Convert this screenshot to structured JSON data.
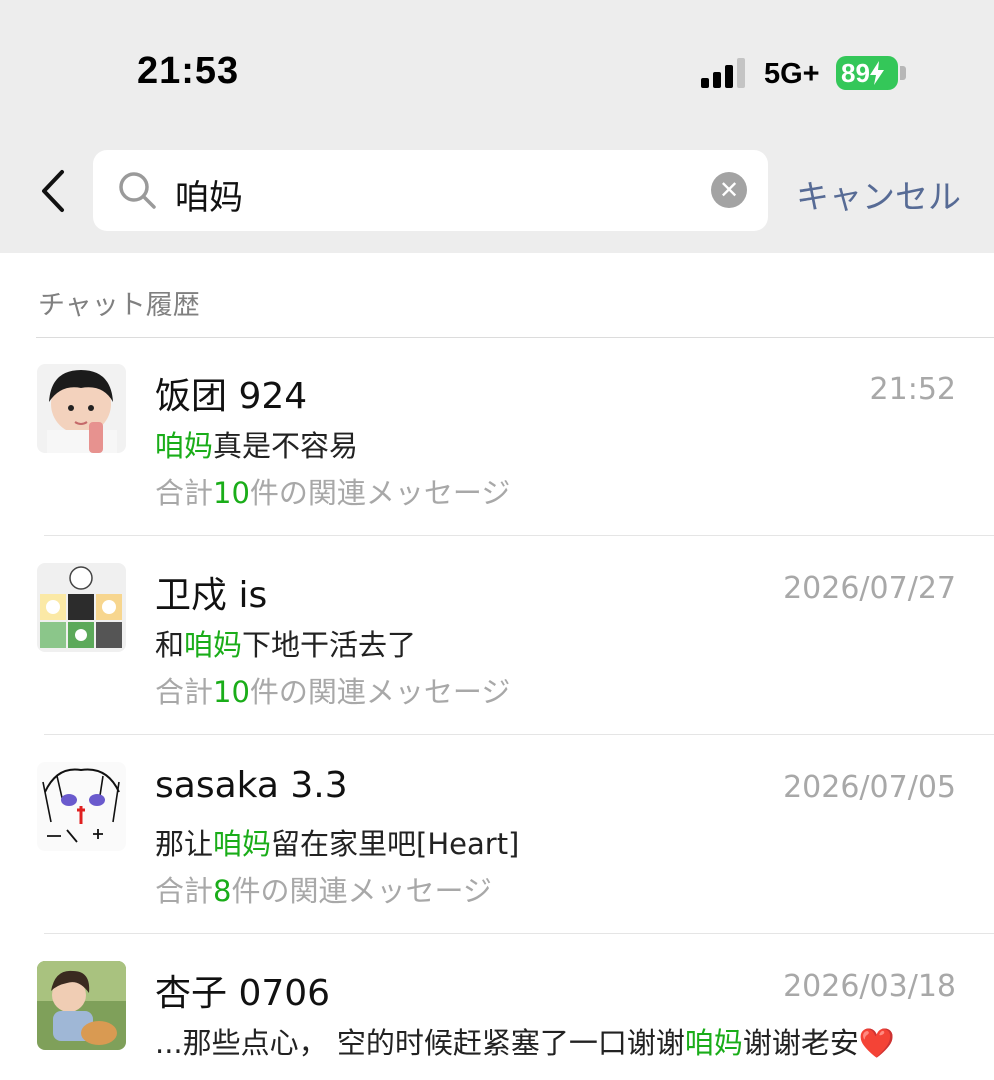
{
  "status_bar": {
    "time": "21:53",
    "network": "5G+",
    "battery": "89"
  },
  "search": {
    "query": "咱妈",
    "cancel_label": "キャンセル"
  },
  "section": {
    "title": "チャット履歴"
  },
  "results": [
    {
      "name": "饭团 924",
      "date": "21:52",
      "snippet_before": "",
      "snippet_highlight": "咱妈",
      "snippet_after": "真是不容易",
      "count_prefix": "合計",
      "count_number": "10",
      "count_suffix": "件の関連メッセージ"
    },
    {
      "name": "卫戍 is",
      "date": "2026/07/27",
      "snippet_before": "和",
      "snippet_highlight": "咱妈",
      "snippet_after": "下地干活去了",
      "count_prefix": "合計",
      "count_number": "10",
      "count_suffix": "件の関連メッセージ"
    },
    {
      "name": "sasaka 3.3",
      "date": "2026/07/05",
      "snippet_before": "那让",
      "snippet_highlight": "咱妈",
      "snippet_after": "留在家里吧[Heart]",
      "count_prefix": "合計",
      "count_number": "8",
      "count_suffix": "件の関連メッセージ"
    },
    {
      "name": "杏子 0706",
      "date": "2026/03/18",
      "snippet_before": "...那些点心， 空的时候赶紧塞了一口谢谢",
      "snippet_highlight": "咱妈",
      "snippet_after": "谢谢老安❤️"
    }
  ],
  "colors": {
    "highlight": "#1aad19",
    "accent": "#576b95",
    "battery": "#34c759"
  }
}
